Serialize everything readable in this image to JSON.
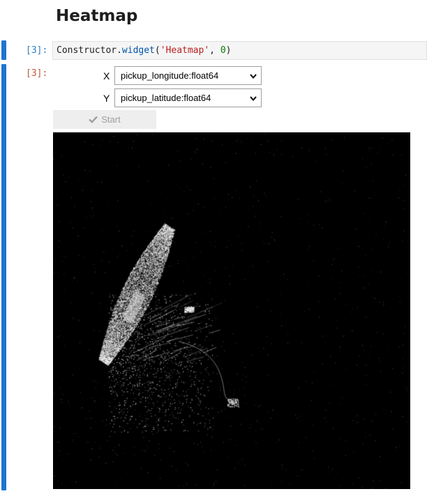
{
  "section": {
    "title": "Heatmap"
  },
  "input_cell": {
    "prompt": "[3]:",
    "code": {
      "object": "Constructor",
      "dot": ".",
      "method": "widget",
      "open": "(",
      "arg_str": "'Heatmap'",
      "sep": ", ",
      "arg_num": "0",
      "close": ")"
    }
  },
  "output_cell": {
    "prompt": "[3]:",
    "x_label": "X",
    "x_value": "pickup_longitude:float64",
    "y_label": "Y",
    "y_value": "pickup_latitude:float64",
    "start_label": "Start",
    "start_icon": "check-icon",
    "heatmap_bg": "#000000",
    "heatmap_fg": "#ffffff"
  },
  "colors": {
    "cell_bar": "#1f74d1",
    "prompt_in": "#307fc1",
    "prompt_out": "#bf5b3d"
  }
}
